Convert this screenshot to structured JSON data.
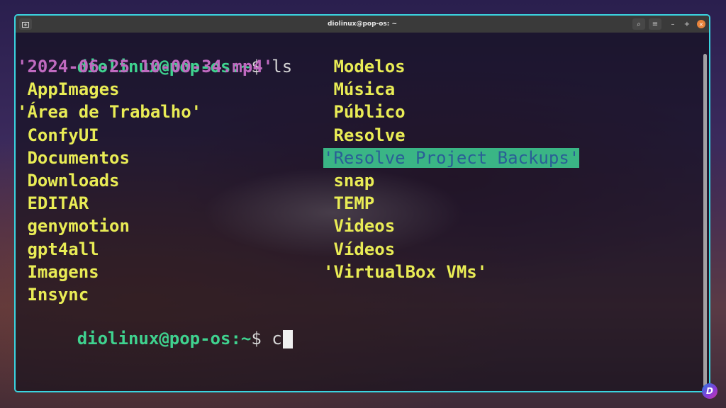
{
  "window": {
    "title": "diolinux@pop-os: ~",
    "buttons": {
      "new_tab_icon": "new-tab-icon",
      "search_icon": "⌕",
      "menu_icon": "≡",
      "minimize": "–",
      "maximize": "+",
      "close": "×"
    }
  },
  "terminal": {
    "prompt_user_host": "diolinux@pop-os",
    "prompt_colon": ":",
    "prompt_tilde": "~",
    "prompt_dollar": "$ ",
    "command1": "ls",
    "current_input": "c",
    "left_column": [
      {
        "text": "'2024-06-25 10-00-34.mp4'",
        "kind": "file-purple"
      },
      {
        "text": " AppImages",
        "kind": "dir"
      },
      {
        "text": "'Área de Trabalho'",
        "kind": "dir"
      },
      {
        "text": " ConfyUI",
        "kind": "dir"
      },
      {
        "text": " Documentos",
        "kind": "dir"
      },
      {
        "text": " Downloads",
        "kind": "dir"
      },
      {
        "text": " EDITAR",
        "kind": "dir"
      },
      {
        "text": " genymotion",
        "kind": "dir"
      },
      {
        "text": " gpt4all",
        "kind": "dir"
      },
      {
        "text": " Imagens",
        "kind": "dir"
      },
      {
        "text": " Insync",
        "kind": "dir"
      }
    ],
    "right_column": [
      {
        "text": " Modelos",
        "kind": "dir"
      },
      {
        "text": " Música",
        "kind": "dir"
      },
      {
        "text": " Público",
        "kind": "dir"
      },
      {
        "text": " Resolve",
        "kind": "dir"
      },
      {
        "text": "'Resolve Project Backups'",
        "kind": "dir-highlight"
      },
      {
        "text": " snap",
        "kind": "dir"
      },
      {
        "text": " TEMP",
        "kind": "dir"
      },
      {
        "text": " Videos",
        "kind": "dir"
      },
      {
        "text": " Vídeos",
        "kind": "dir"
      },
      {
        "text": "'VirtualBox VMs'",
        "kind": "dir"
      }
    ]
  },
  "overlay": {
    "brand_badge": "D"
  },
  "colors": {
    "window_border": "#3ad4e0",
    "prompt_green": "#3fd28f",
    "dir_yellow": "#e9ec55",
    "video_purple": "#c06ac0",
    "highlight_bg": "#3ab585",
    "highlight_fg": "#2a5f96",
    "close_orange": "#e8843c"
  }
}
